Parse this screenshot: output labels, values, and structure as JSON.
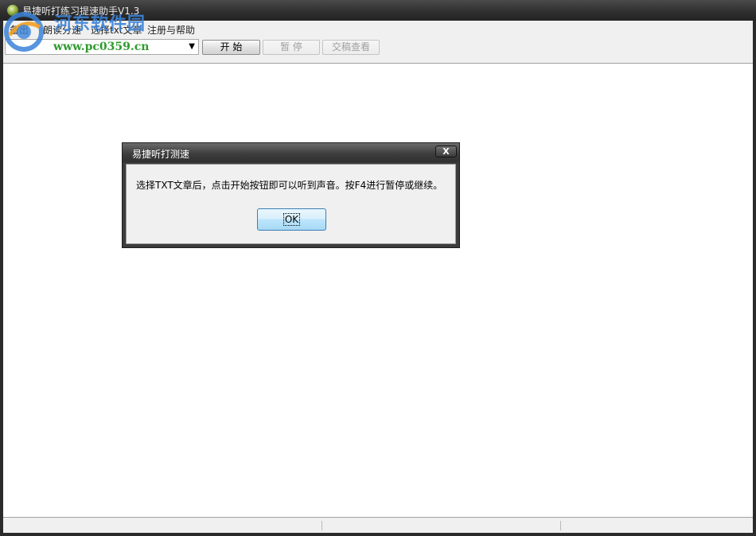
{
  "window": {
    "title": "易捷听打练习提速助手V1.3"
  },
  "menu": {
    "items": [
      "备出",
      "朗读分速",
      "选择txt文章",
      "注册与帮助"
    ]
  },
  "toolbar": {
    "combo_value": "www.pc0359.cn",
    "start_label": "开 始",
    "pause_label": "暂 停",
    "submit_label": "交稿查看"
  },
  "watermark": {
    "brand_text": "河东软件园"
  },
  "dialog": {
    "title": "易捷听打测速",
    "close_label": "X",
    "message": "选择TXT文章后，点击开始按钮即可以听到声音。按F4进行暂停或继续。",
    "ok_label": "OK"
  },
  "colors": {
    "title_bar": "#2e2e2e",
    "url_green": "#2e9c2e",
    "ok_button_blue": "#bee6fd",
    "watermark_blue": "#3b83d8"
  }
}
